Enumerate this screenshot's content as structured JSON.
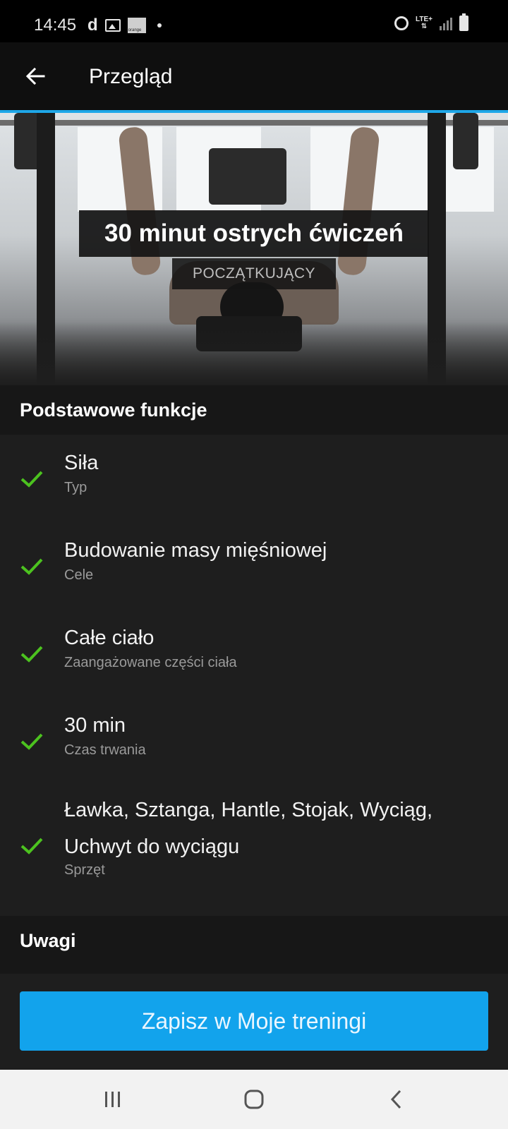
{
  "status_bar": {
    "time": "14:45",
    "left_icons": [
      "d-app-icon",
      "gallery-icon",
      "orange-icon",
      "dot-icon"
    ],
    "carrier_badge": "orange",
    "right_icons": [
      "alarm-icon",
      "lte-icon",
      "signal-icon",
      "battery-icon"
    ],
    "lte_label": "LTE+"
  },
  "app_bar": {
    "title": "Przegląd",
    "back_icon": "arrow-left-icon",
    "accent_color": "#1ea7e8"
  },
  "hero": {
    "title": "30 minut ostrych ćwiczeń",
    "level": "POCZĄTKUJĄCY"
  },
  "basics_section": {
    "header": "Podstawowe funkcje",
    "items": [
      {
        "value": "Siła",
        "label": "Typ"
      },
      {
        "value": "Budowanie masy mięśniowej",
        "label": "Cele"
      },
      {
        "value": "Całe ciało",
        "label": "Zaangażowane części ciała"
      },
      {
        "value": "30 min",
        "label": "Czas trwania"
      },
      {
        "value": "Ławka, Sztanga, Hantle, Stojak, Wyciąg, Uchwyt do wyciągu",
        "label": "Sprzęt"
      }
    ],
    "check_color": "#4cc21f"
  },
  "notes_section": {
    "header": "Uwagi"
  },
  "save_button": {
    "label": "Zapisz w Moje treningi",
    "color": "#12a3ec"
  },
  "nav_bar": {
    "icons": [
      "recent-apps-icon",
      "home-icon",
      "back-nav-icon"
    ]
  }
}
